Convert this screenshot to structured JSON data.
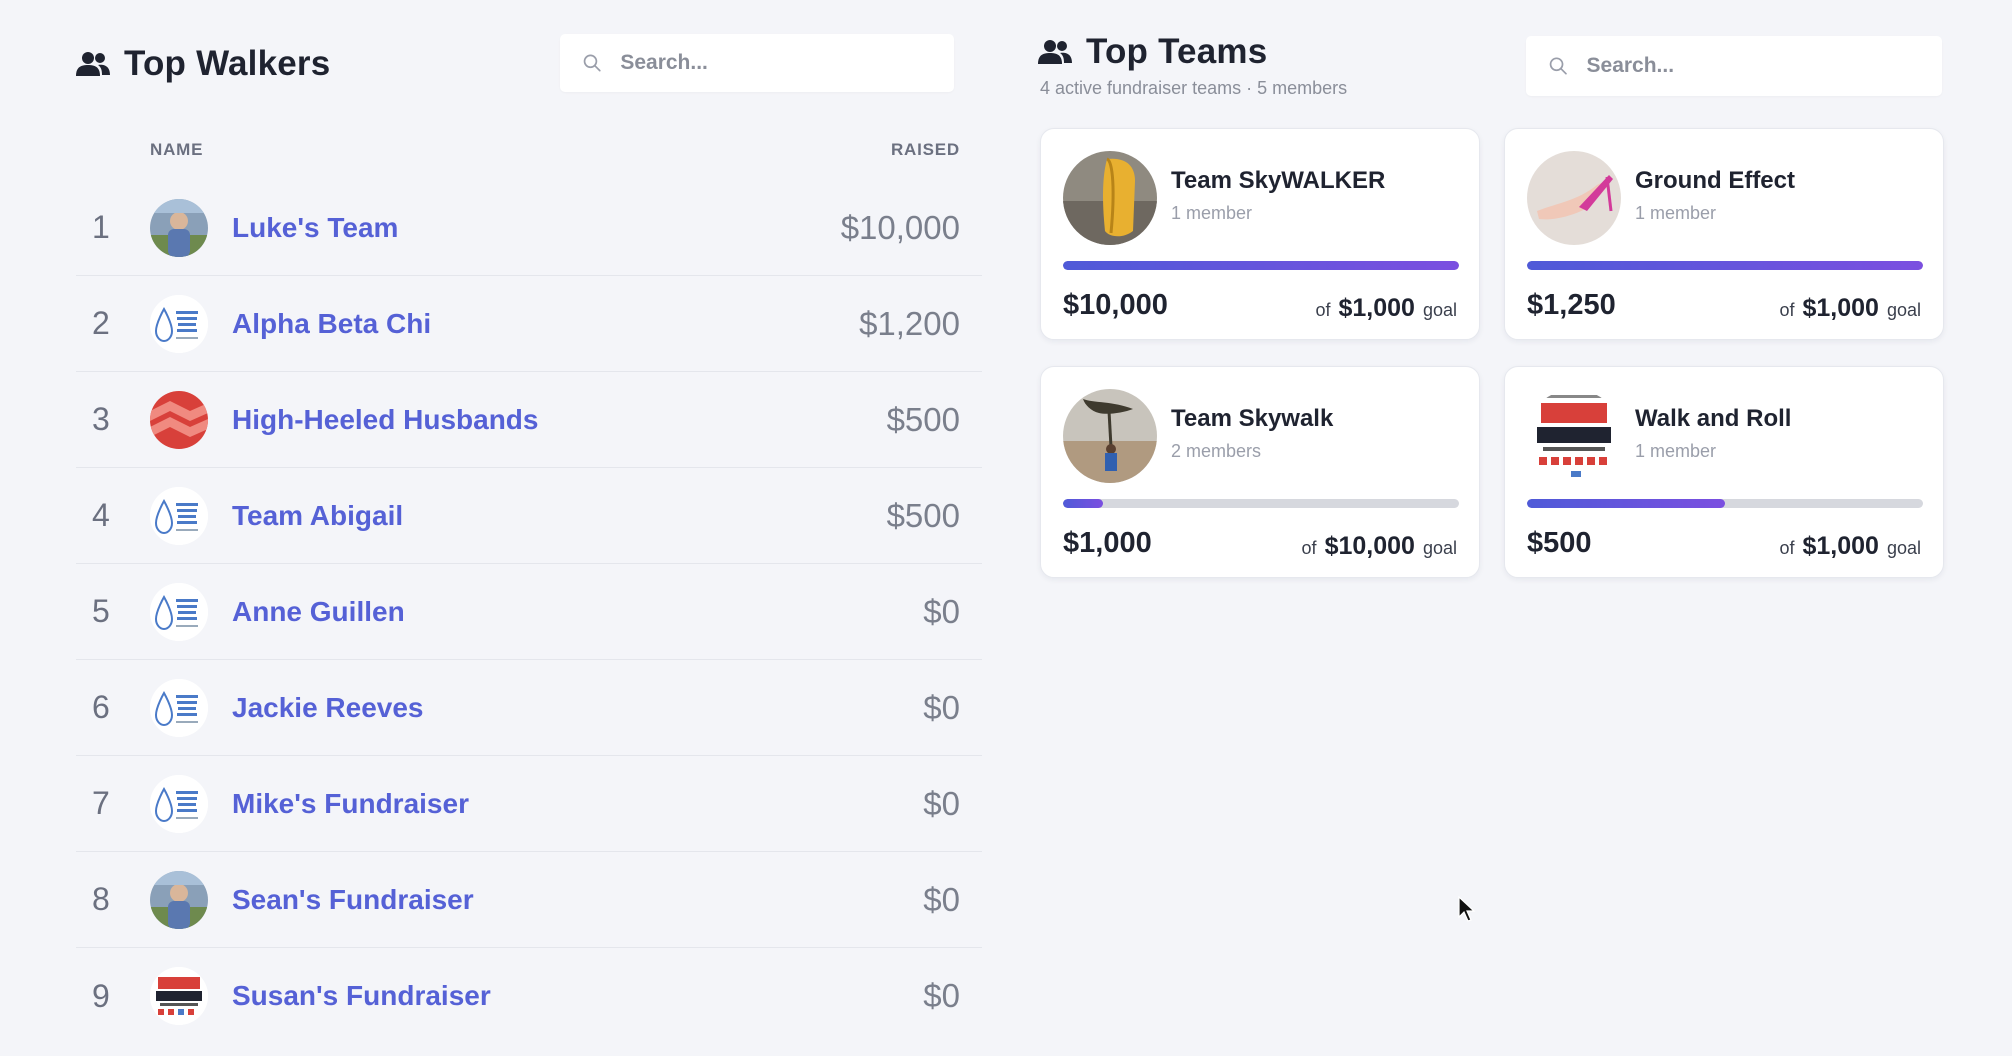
{
  "walkers": {
    "title": "Top Walkers",
    "icon": "people-icon",
    "search_placeholder": "Search...",
    "columns": {
      "name": "NAME",
      "raised": "RAISED"
    },
    "rows": [
      {
        "rank": "1",
        "name": "Luke's Team",
        "amount": "$10,000",
        "avatar": "person-photo"
      },
      {
        "rank": "2",
        "name": "Alpha Beta Chi",
        "amount": "$1,200",
        "avatar": "water-drop-logo"
      },
      {
        "rank": "3",
        "name": "High-Heeled Husbands",
        "amount": "$500",
        "avatar": "red-pattern"
      },
      {
        "rank": "4",
        "name": "Team Abigail",
        "amount": "$500",
        "avatar": "water-drop-logo"
      },
      {
        "rank": "5",
        "name": "Anne Guillen",
        "amount": "$0",
        "avatar": "water-drop-logo"
      },
      {
        "rank": "6",
        "name": "Jackie Reeves",
        "amount": "$0",
        "avatar": "water-drop-logo"
      },
      {
        "rank": "7",
        "name": "Mike's Fundraiser",
        "amount": "$0",
        "avatar": "water-drop-logo"
      },
      {
        "rank": "8",
        "name": "Sean's Fundraiser",
        "amount": "$0",
        "avatar": "person-photo"
      },
      {
        "rank": "9",
        "name": "Susan's Fundraiser",
        "amount": "$0",
        "avatar": "walk-a-mile-logo"
      }
    ]
  },
  "teams": {
    "title": "Top Teams",
    "icon": "people-icon",
    "subtitle": "4 active fundraiser teams · 5 members",
    "search_placeholder": "Search...",
    "goal_prefix": "of",
    "goal_suffix": "goal",
    "cards": [
      {
        "name": "Team SkyWALKER",
        "members": "1 member",
        "raised": "$10,000",
        "goal": "$1,000",
        "progress": 1.0,
        "avatar": "yellow-object-photo"
      },
      {
        "name": "Ground Effect",
        "members": "1 member",
        "raised": "$1,250",
        "goal": "$1,000",
        "progress": 1.0,
        "avatar": "pink-heels-photo"
      },
      {
        "name": "Team Skywalk",
        "members": "2 members",
        "raised": "$1,000",
        "goal": "$10,000",
        "progress": 0.1,
        "avatar": "desert-photo"
      },
      {
        "name": "Walk and Roll",
        "members": "1 member",
        "raised": "$500",
        "goal": "$1,000",
        "progress": 0.5,
        "avatar": "walk-a-mile-logo"
      }
    ]
  },
  "colors": {
    "link": "#5561d6",
    "progress_start": "#4f5ad8",
    "progress_end": "#7b4fe0",
    "background": "#f4f5f9"
  }
}
